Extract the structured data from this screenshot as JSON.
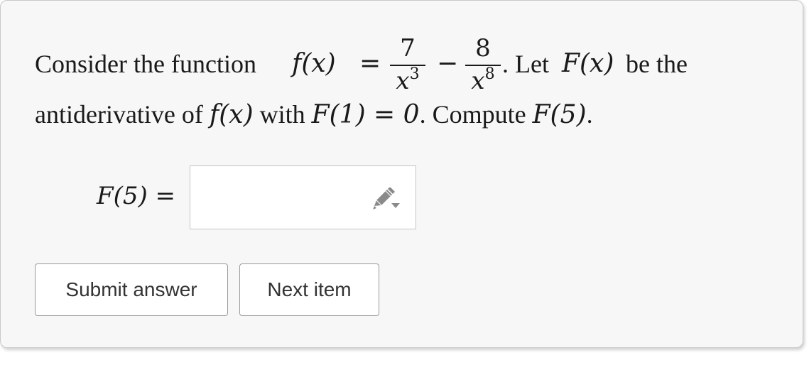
{
  "problem": {
    "intro": "Consider the function ",
    "f_of_x": "f(x)",
    "equals": "=",
    "frac1_num": "7",
    "frac1_den_base": "x",
    "frac1_den_exp": "3",
    "minus": "−",
    "frac2_num": "8",
    "frac2_den_base": "x",
    "frac2_den_exp": "8",
    "period_let": ". Let ",
    "F_of_x": "F(x)",
    "be_the": " be the",
    "line2_start": "antiderivative of ",
    "line2_f": "f(x)",
    "line2_with": " with ",
    "line2_cond": "F(1) = 0",
    "line2_compute": ". Compute ",
    "line2_target": "F(5)",
    "line2_end": "."
  },
  "answer": {
    "label": "F(5) =",
    "value": ""
  },
  "buttons": {
    "submit_label": "Submit answer",
    "next_label": "Next item"
  },
  "icons": {
    "input_icon": "pencil-dropdown-icon"
  },
  "colors": {
    "card_background": "#f7f7f7",
    "text": "#1a1a1a",
    "button_text": "#333333",
    "icon": "#8a8a8a"
  }
}
